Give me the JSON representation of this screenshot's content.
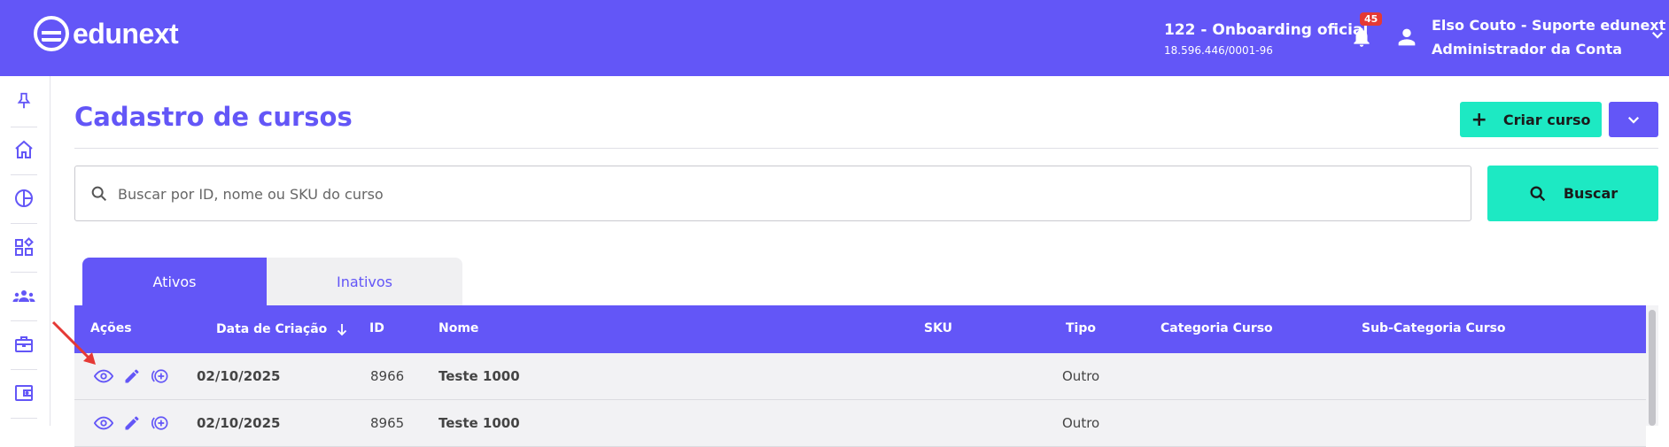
{
  "brand": {
    "name": "edunext"
  },
  "header": {
    "org_name": "122 - Onboarding oficial",
    "org_doc": "18.596.446/0001-96",
    "notifications_count": "45",
    "user_name": "Elso Couto - Suporte edunext",
    "user_role": "Administrador da Conta"
  },
  "sidebar": {
    "items": [
      {
        "icon": "pin-icon"
      },
      {
        "icon": "home-icon"
      },
      {
        "icon": "chart-pie-icon"
      },
      {
        "icon": "apps-icon"
      },
      {
        "icon": "groups-icon"
      },
      {
        "icon": "briefcase-icon"
      },
      {
        "icon": "wallet-icon"
      }
    ]
  },
  "page": {
    "title": "Cadastro de cursos",
    "create_label": "Criar curso",
    "search_placeholder": "Buscar por ID, nome ou SKU do curso",
    "search_label": "Buscar"
  },
  "tabs": [
    {
      "label": "Ativos",
      "active": true
    },
    {
      "label": "Inativos",
      "active": false
    }
  ],
  "table": {
    "columns": [
      "Ações",
      "Data de Criação",
      "ID",
      "Nome",
      "SKU",
      "Tipo",
      "Categoria Curso",
      "Sub-Categoria Curso"
    ],
    "rows": [
      {
        "date": "02/10/2025",
        "id": "8966",
        "name": "Teste 1000",
        "sku": "",
        "type": "Outro",
        "category": "",
        "subcategory": ""
      },
      {
        "date": "02/10/2025",
        "id": "8965",
        "name": "Teste 1000",
        "sku": "",
        "type": "Outro",
        "category": "",
        "subcategory": ""
      }
    ]
  },
  "colors": {
    "primary": "#6356f7",
    "accent": "#1de9c3",
    "badge": "#e53935",
    "annotation_arrow": "#e53935"
  }
}
